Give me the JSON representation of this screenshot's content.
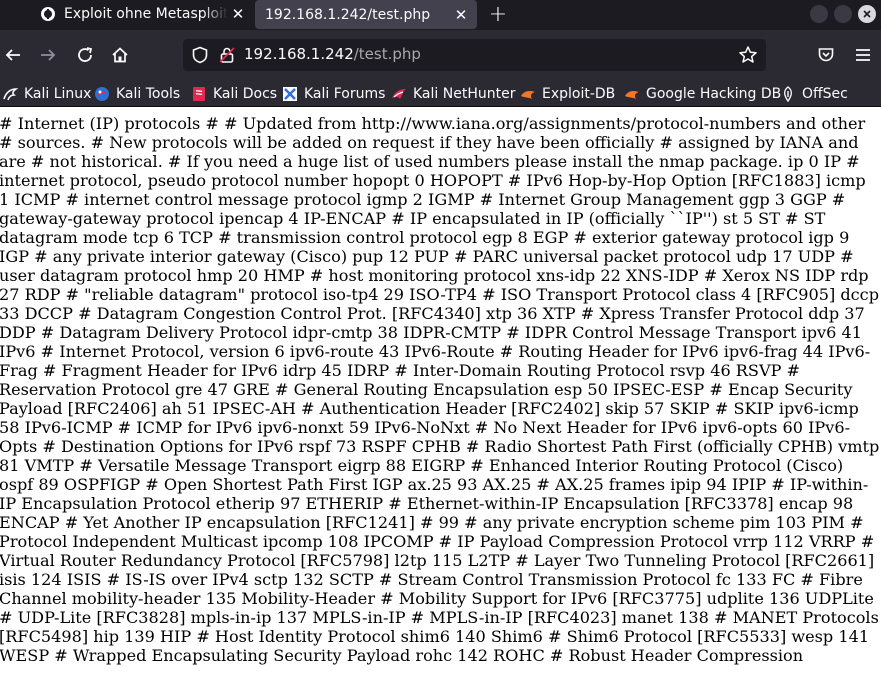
{
  "tabs": [
    {
      "title": "Exploit ohne Metasploit si",
      "active": false
    },
    {
      "title": "192.168.1.242/test.php",
      "active": true
    }
  ],
  "navbar": {
    "url_host": "192.168.1.242",
    "url_path": "/test.php"
  },
  "bookmarks": [
    {
      "label": "Kali Linux",
      "icon": "kali-dragon-icon"
    },
    {
      "label": "Kali Tools",
      "icon": "kali-tools-icon"
    },
    {
      "label": "Kali Docs",
      "icon": "kali-docs-icon"
    },
    {
      "label": "Kali Forums",
      "icon": "kali-forums-icon"
    },
    {
      "label": "Kali NetHunter",
      "icon": "nethunter-icon"
    },
    {
      "label": "Exploit-DB",
      "icon": "exploit-db-icon"
    },
    {
      "label": "Google Hacking DB",
      "icon": "ghdb-icon"
    },
    {
      "label": "OffSec",
      "icon": "offsec-icon"
    }
  ],
  "page": {
    "body_text": "# Internet (IP) protocols # # Updated from http://www.iana.org/assignments/protocol-numbers and other # sources. # New protocols will be added on request if they have been officially # assigned by IANA and are # not historical. # If you need a huge list of used numbers please install the nmap package. ip 0 IP # internet protocol, pseudo protocol number hopopt 0 HOPOPT # IPv6 Hop-by-Hop Option [RFC1883] icmp 1 ICMP # internet control message protocol igmp 2 IGMP # Internet Group Management ggp 3 GGP # gateway-gateway protocol ipencap 4 IP-ENCAP # IP encapsulated in IP (officially ``IP'') st 5 ST # ST datagram mode tcp 6 TCP # transmission control protocol egp 8 EGP # exterior gateway protocol igp 9 IGP # any private interior gateway (Cisco) pup 12 PUP # PARC universal packet protocol udp 17 UDP # user datagram protocol hmp 20 HMP # host monitoring protocol xns-idp 22 XNS-IDP # Xerox NS IDP rdp 27 RDP # \"reliable datagram\" protocol iso-tp4 29 ISO-TP4 # ISO Transport Protocol class 4 [RFC905] dccp 33 DCCP # Datagram Congestion Control Prot. [RFC4340] xtp 36 XTP # Xpress Transfer Protocol ddp 37 DDP # Datagram Delivery Protocol idpr-cmtp 38 IDPR-CMTP # IDPR Control Message Transport ipv6 41 IPv6 # Internet Protocol, version 6 ipv6-route 43 IPv6-Route # Routing Header for IPv6 ipv6-frag 44 IPv6-Frag # Fragment Header for IPv6 idrp 45 IDRP # Inter-Domain Routing Protocol rsvp 46 RSVP # Reservation Protocol gre 47 GRE # General Routing Encapsulation esp 50 IPSEC-ESP # Encap Security Payload [RFC2406] ah 51 IPSEC-AH # Authentication Header [RFC2402] skip 57 SKIP # SKIP ipv6-icmp 58 IPv6-ICMP # ICMP for IPv6 ipv6-nonxt 59 IPv6-NoNxt # No Next Header for IPv6 ipv6-opts 60 IPv6-Opts # Destination Options for IPv6 rspf 73 RSPF CPHB # Radio Shortest Path First (officially CPHB) vmtp 81 VMTP # Versatile Message Transport eigrp 88 EIGRP # Enhanced Interior Routing Protocol (Cisco) ospf 89 OSPFIGP # Open Shortest Path First IGP ax.25 93 AX.25 # AX.25 frames ipip 94 IPIP # IP-within-IP Encapsulation Protocol etherip 97 ETHERIP # Ethernet-within-IP Encapsulation [RFC3378] encap 98 ENCAP # Yet Another IP encapsulation [RFC1241] # 99 # any private encryption scheme pim 103 PIM # Protocol Independent Multicast ipcomp 108 IPCOMP # IP Payload Compression Protocol vrrp 112 VRRP # Virtual Router Redundancy Protocol [RFC5798] l2tp 115 L2TP # Layer Two Tunneling Protocol [RFC2661] isis 124 ISIS # IS-IS over IPv4 sctp 132 SCTP # Stream Control Transmission Protocol fc 133 FC # Fibre Channel mobility-header 135 Mobility-Header # Mobility Support for IPv6 [RFC3775] udplite 136 UDPLite # UDP-Lite [RFC3828] mpls-in-ip 137 MPLS-in-IP # MPLS-in-IP [RFC4023] manet 138 # MANET Protocols [RFC5498] hip 139 HIP # Host Identity Protocol shim6 140 Shim6 # Shim6 Protocol [RFC5533] wesp 141 WESP # Wrapped Encapsulating Security Payload rohc 142 ROHC # Robust Header Compression"
  },
  "colors": {
    "tabstrip_bg": "#1c1b22",
    "toolbar_bg": "#2b2a33",
    "active_tab_bg": "#42414d",
    "text_light": "#fbfbfe",
    "page_bg": "#ffffff"
  }
}
